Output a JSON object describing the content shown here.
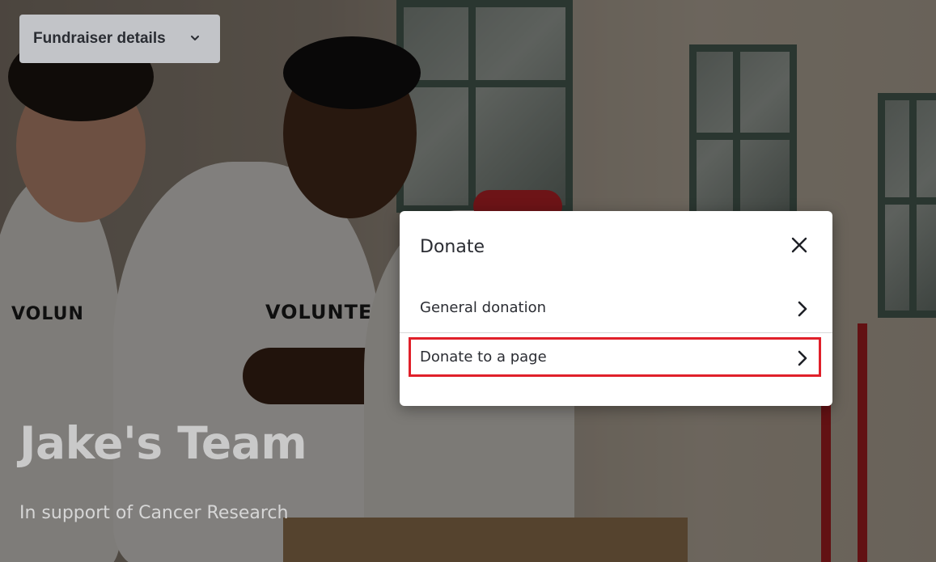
{
  "header": {
    "details_button_label": "Fundraiser details"
  },
  "hero": {
    "title": "Jake's Team",
    "subtitle": "In support of Cancer Research",
    "shirt_texts": [
      "VOLUNTEER",
      "VOLUNTEER"
    ]
  },
  "modal": {
    "title": "Donate",
    "options": [
      {
        "label": "General donation"
      },
      {
        "label": "Donate to a page"
      }
    ]
  },
  "colors": {
    "button_bg": "#c2c4c8",
    "highlight": "#e0202a",
    "modal_bg": "#ffffff",
    "text_dark": "#2b2d33"
  },
  "icons": {
    "details_toggle": "chevron-down-icon",
    "close": "close-icon",
    "option_arrow": "chevron-right-icon"
  }
}
